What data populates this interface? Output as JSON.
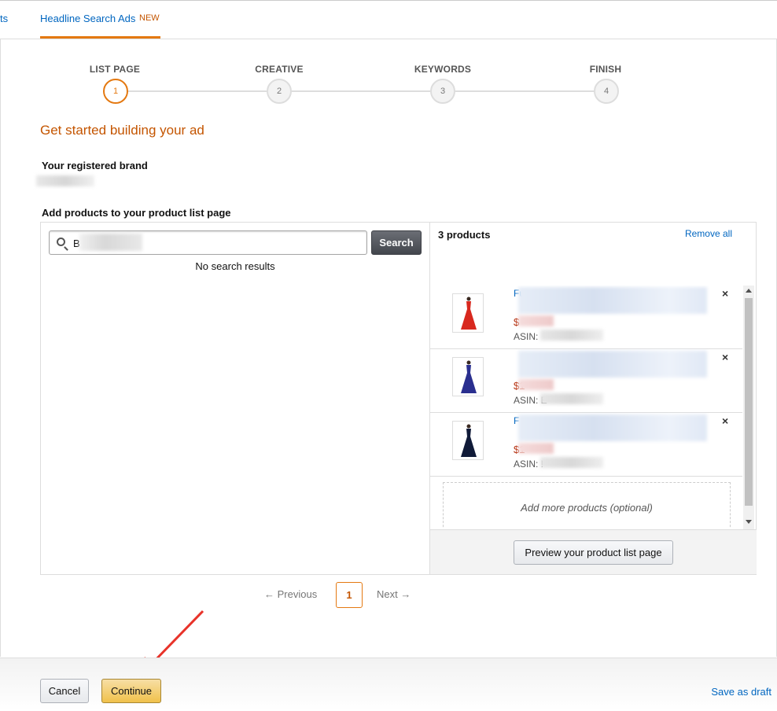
{
  "tabs": {
    "partial_label": "ts",
    "active_label": "Headline Search Ads",
    "new_badge": "NEW"
  },
  "stepper": {
    "steps": [
      {
        "label": "LIST PAGE",
        "number": "1",
        "active": true
      },
      {
        "label": "CREATIVE",
        "number": "2",
        "active": false
      },
      {
        "label": "KEYWORDS",
        "number": "3",
        "active": false
      },
      {
        "label": "FINISH",
        "number": "4",
        "active": false
      }
    ]
  },
  "main": {
    "heading": "Get started building your ad",
    "brand_label": "Your registered brand",
    "products_label": "Add products to your product list page"
  },
  "search": {
    "value": "B",
    "button_label": "Search",
    "no_results": "No search results"
  },
  "selected": {
    "count_label": "3 products",
    "remove_all": "Remove all",
    "items": [
      {
        "name": "Fu",
        "price": "$",
        "asin": "ASIN:",
        "dress_color": "#d8281e"
      },
      {
        "name": "",
        "price": "$1",
        "asin": "ASIN: E",
        "dress_color": "#2a2f8f"
      },
      {
        "name": "F",
        "price": "$1",
        "asin": "ASIN: !",
        "dress_color": "#101a38"
      }
    ],
    "remove_icon": "×",
    "add_more": "Add more products (optional)",
    "preview_button": "Preview your product list page"
  },
  "pagination": {
    "previous": "← Previous",
    "current": "1",
    "next": "Next →"
  },
  "footer": {
    "cancel": "Cancel",
    "continue": "Continue",
    "save_draft": "Save as draft"
  },
  "colors": {
    "accent": "#e47911",
    "heading": "#c45500",
    "link": "#0066c0",
    "price": "#b12704",
    "annotation_arrow": "#e8332a"
  }
}
